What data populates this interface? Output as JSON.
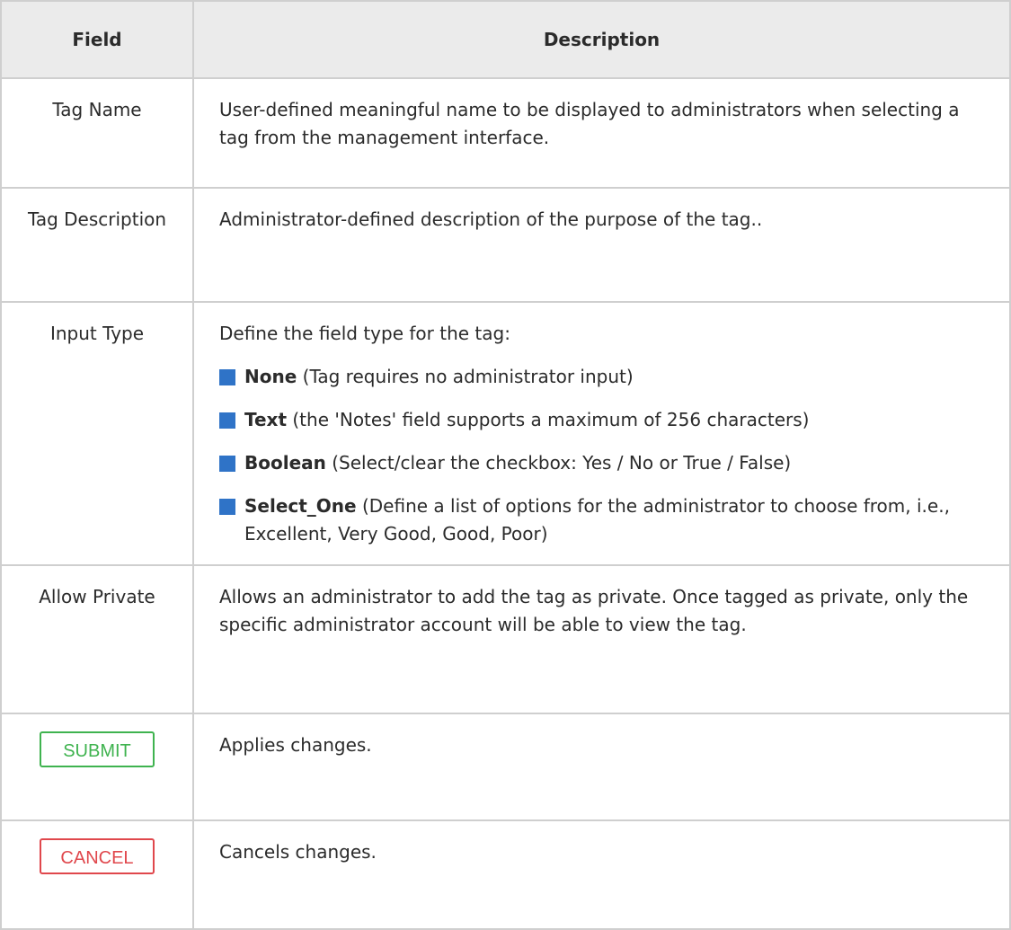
{
  "table": {
    "headers": {
      "field": "Field",
      "description": "Description"
    },
    "rows": {
      "tag_name": {
        "field": "Tag Name",
        "description": "User-defined meaningful name to be displayed to administrators when selecting a tag from the management interface."
      },
      "tag_description": {
        "field": "Tag Description",
        "description": "Administrator-defined description of the purpose of the tag.."
      },
      "input_type": {
        "field": "Input Type",
        "intro": "Define the field type for the tag:",
        "options": [
          {
            "name": "None",
            "detail": " (Tag requires no administrator input)"
          },
          {
            "name": "Text",
            "detail": " (the 'Notes' field supports a maximum of 256 characters)"
          },
          {
            "name": "Boolean",
            "detail": " (Select/clear the checkbox: Yes / No or True / False)"
          },
          {
            "name": "Select_One",
            "detail": " (Define a list of options for the administrator to choose from, i.e., Excellent, Very Good, Good, Poor)"
          }
        ]
      },
      "allow_private": {
        "field": "Allow Private",
        "description": "Allows an administrator to add the tag as private. Once tagged as private, only the specific administrator account will be able to view the tag."
      },
      "submit": {
        "button_label": "SUBMIT",
        "description": "Applies changes."
      },
      "cancel": {
        "button_label": "CANCEL",
        "description": "Cancels changes."
      }
    }
  },
  "colors": {
    "bullet": "#2f73c7",
    "submit": "#3fb34f",
    "cancel": "#e0474c",
    "header_bg": "#ebebeb",
    "border": "#cfcfcf"
  }
}
